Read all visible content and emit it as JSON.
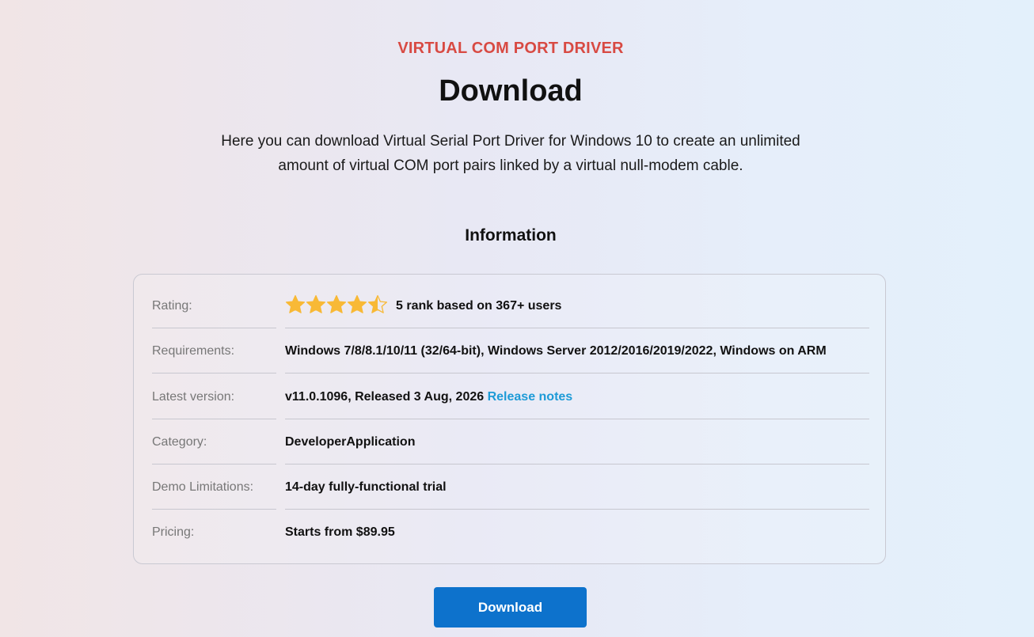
{
  "hero": {
    "eyebrow": "VIRTUAL COM PORT DRIVER",
    "title": "Download",
    "description": "Here you can download Virtual Serial Port Driver for Windows 10 to create an unlimited amount of virtual COM port pairs linked by a virtual null-modem cable."
  },
  "info": {
    "heading": "Information",
    "rating": {
      "label": "Rating:",
      "stars_filled": 4.5,
      "stars_total": 5,
      "text": "5 rank based on 367+ users",
      "star_color": "#f8b936"
    },
    "requirements": {
      "label": "Requirements:",
      "value": "Windows 7/8/8.1/10/11 (32/64-bit), Windows Server 2012/2016/2019/2022, Windows on ARM"
    },
    "latest_version": {
      "label": "Latest version:",
      "value": "v11.0.1096, Released 3 Aug, 2026",
      "link_label": "Release notes"
    },
    "category": {
      "label": "Category:",
      "value": "DeveloperApplication"
    },
    "demo_limitations": {
      "label": "Demo Limitations:",
      "value": "14-day fully-functional trial"
    },
    "pricing": {
      "label": "Pricing:",
      "value": "Starts from $89.95"
    }
  },
  "cta": {
    "download_label": "Download",
    "color": "#0d72cc"
  },
  "colors": {
    "eyebrow": "#d84a43",
    "link": "#1e9bd7"
  }
}
